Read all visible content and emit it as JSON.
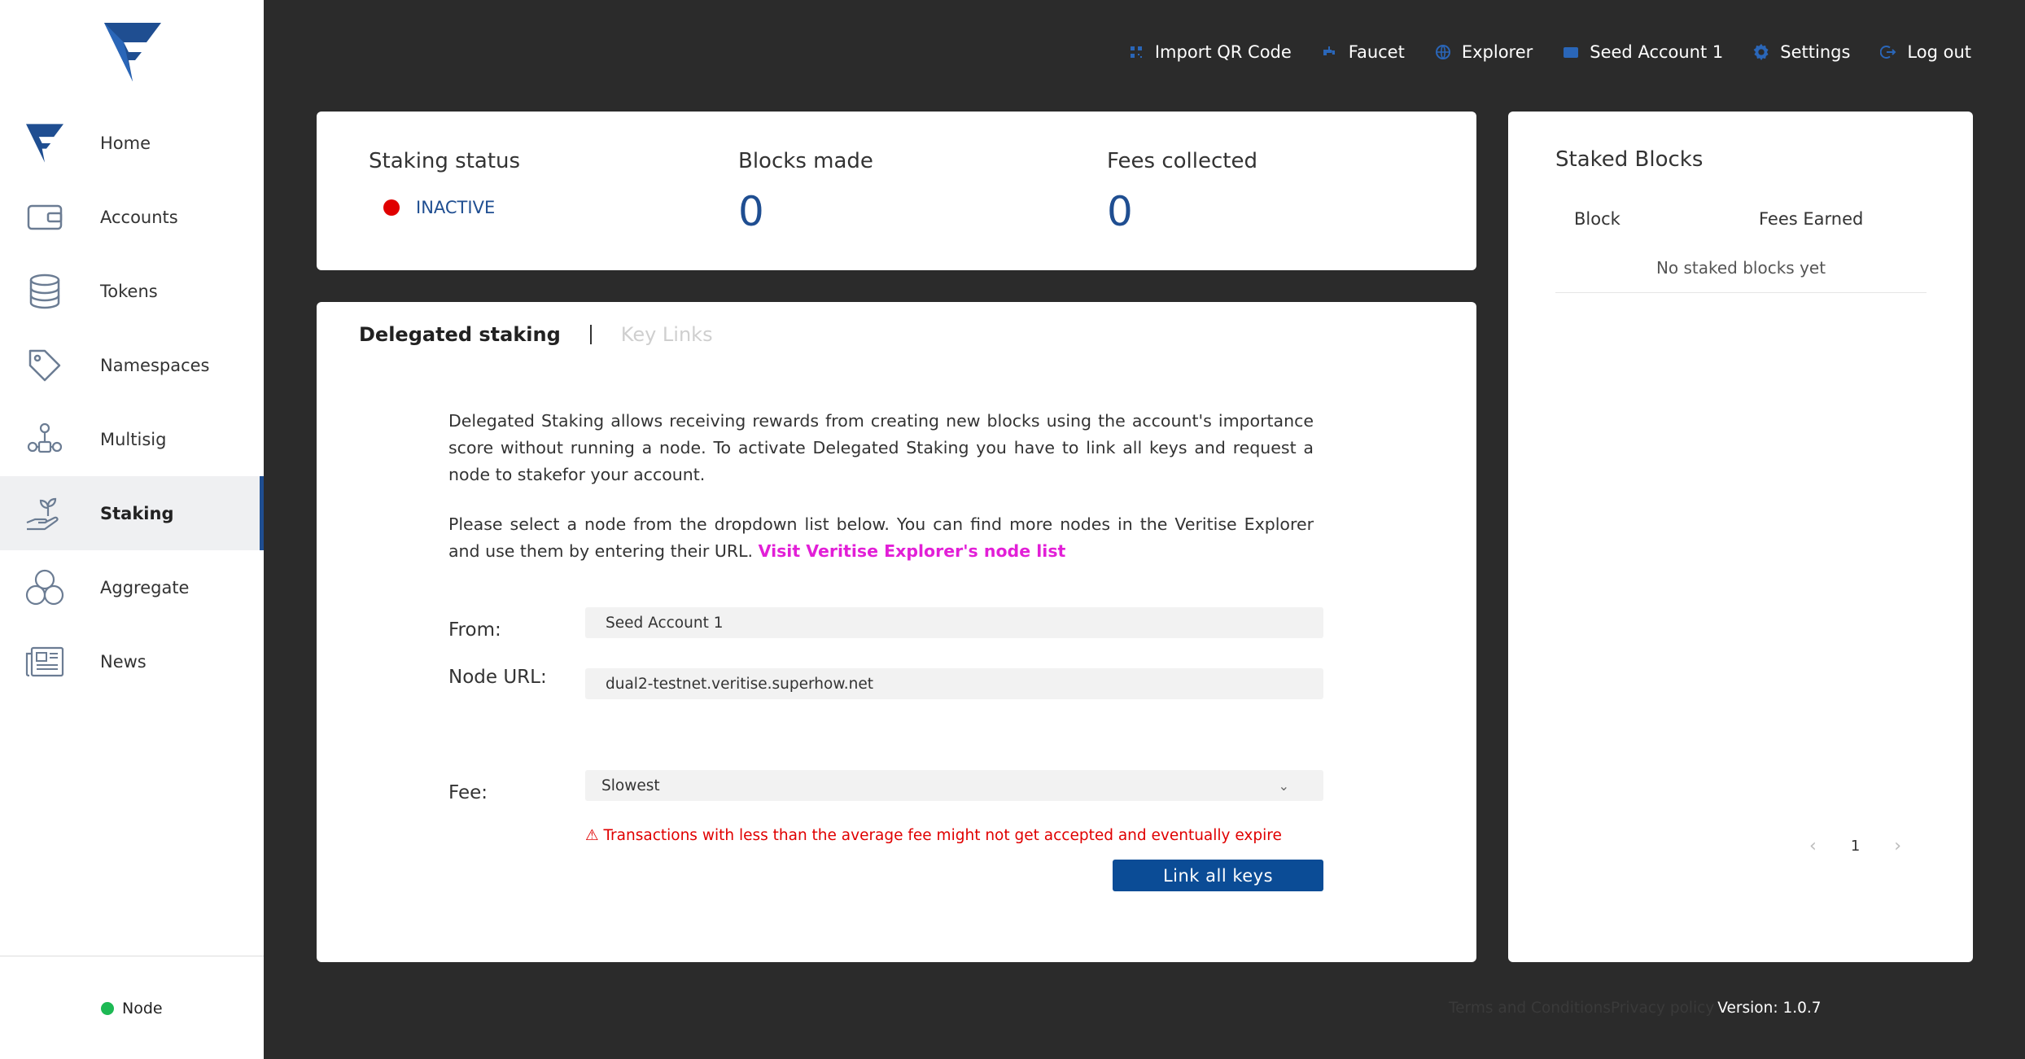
{
  "app": {
    "brand_color": "#1f4e91",
    "accent_link": "#e21fd7"
  },
  "sidebar": {
    "items": [
      {
        "label": "Home",
        "icon": "home-logo-icon"
      },
      {
        "label": "Accounts",
        "icon": "wallet-icon"
      },
      {
        "label": "Tokens",
        "icon": "coins-icon"
      },
      {
        "label": "Namespaces",
        "icon": "tag-icon"
      },
      {
        "label": "Multisig",
        "icon": "multisig-icon"
      },
      {
        "label": "Staking",
        "icon": "staking-plant-icon",
        "active": true
      },
      {
        "label": "Aggregate",
        "icon": "aggregate-icon"
      },
      {
        "label": "News",
        "icon": "newspaper-icon"
      }
    ],
    "node": {
      "label": "Node",
      "status_color": "#1db954"
    }
  },
  "topbar": {
    "import_qr": "Import QR Code",
    "faucet": "Faucet",
    "explorer": "Explorer",
    "account": "Seed Account 1",
    "settings": "Settings",
    "logout": "Log out"
  },
  "status_card": {
    "staking_status_title": "Staking status",
    "staking_status_value": "INACTIVE",
    "status_color": "#e00000",
    "blocks_made_title": "Blocks made",
    "blocks_made_value": "0",
    "fees_collected_title": "Fees collected",
    "fees_collected_value": "0"
  },
  "main": {
    "tab_active": "Delegated staking",
    "tab_inactive": "Key Links",
    "description_1": "Delegated Staking allows receiving rewards from creating new blocks using the account's importance score without running a node. To activate Delegated Staking you have to link all keys and request a node to stakefor your account.",
    "description_2": "Please select a node from the dropdown list below. You can find more nodes in the Veritise Explorer and use them by entering their URL.",
    "explorer_link": "Visit Veritise Explorer's node list",
    "from_label": "From:",
    "from_value": "Seed Account 1",
    "node_url_label": "Node URL:",
    "node_url_value": "dual2-testnet.veritise.superhow.net",
    "fee_label": "Fee:",
    "fee_value": "Slowest",
    "fee_warning": "⚠ Transactions with less than the average fee might not get accepted and eventually expire",
    "link_button": "Link all keys"
  },
  "staked_blocks": {
    "title": "Staked Blocks",
    "col_block": "Block",
    "col_fees": "Fees Earned",
    "empty": "No staked blocks yet",
    "page": "1",
    "prev": "‹",
    "next": "›"
  },
  "footer": {
    "terms": "Terms and Conditions",
    "privacy": "Privacy policy",
    "version": "Version: 1.0.7"
  }
}
